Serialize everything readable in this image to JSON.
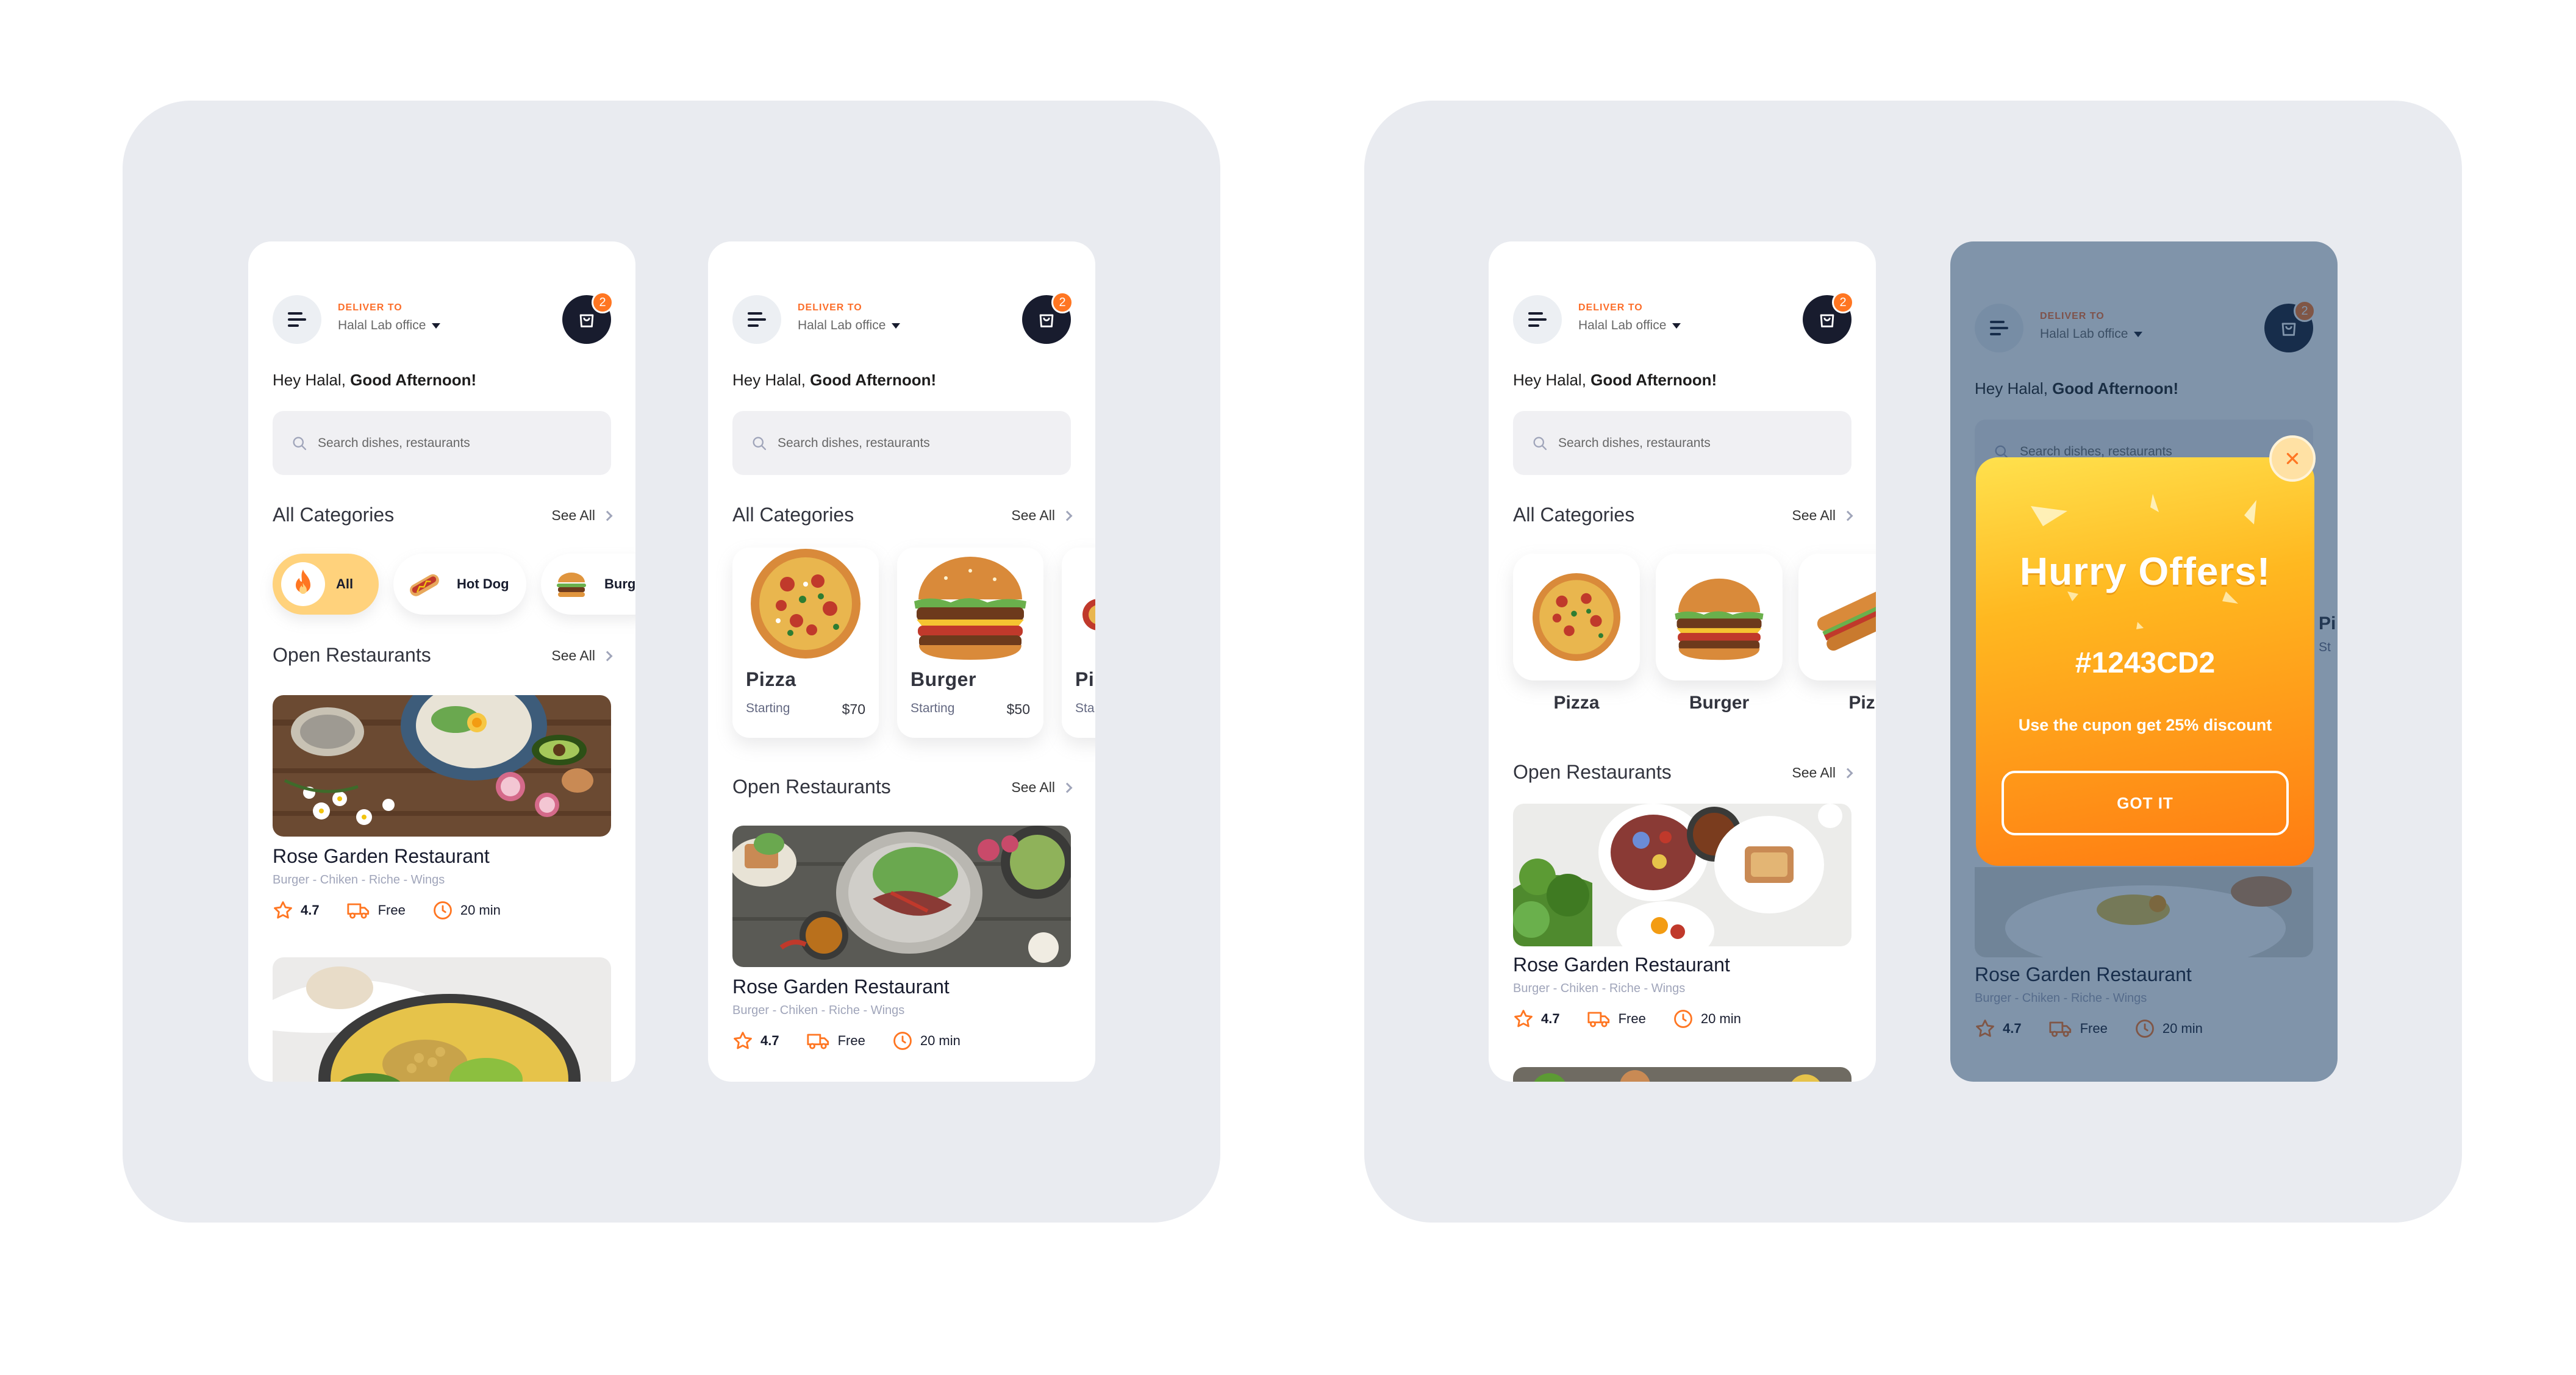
{
  "common": {
    "deliver_to": "DELIVER TO",
    "location": "Halal Lab office",
    "cart_count": "2",
    "greeting_prefix": "Hey Halal, ",
    "greeting_strong": "Good Afternoon!",
    "search_placeholder": "Search dishes, restaurants",
    "categories_title": "All Categories",
    "see_all": "See All",
    "restaurants_title": "Open Restaurants",
    "accent": "#FF7622"
  },
  "screen1": {
    "pills": [
      "All",
      "Hot Dog",
      "Burg"
    ]
  },
  "screen2": {
    "categories": [
      {
        "name": "Pizza",
        "starting": "Starting",
        "price": "$70"
      },
      {
        "name": "Burger",
        "starting": "Starting",
        "price": "$50"
      },
      {
        "name": "Pi",
        "starting": "Sta",
        "price": ""
      }
    ]
  },
  "screen3": {
    "categories": [
      "Pizza",
      "Burger",
      "Piz"
    ]
  },
  "screen4": {
    "partial_label": "Pi",
    "partial_sub": "St"
  },
  "restaurant": {
    "name": "Rose Garden Restaurant",
    "tags": "Burger - Chiken - Riche - Wings",
    "rating": "4.7",
    "delivery": "Free",
    "time": "20 min"
  },
  "popup": {
    "title": "Hurry Offers!",
    "code": "#1243CD2",
    "description": "Use the cupon get 25% discount",
    "button": "GOT IT"
  }
}
